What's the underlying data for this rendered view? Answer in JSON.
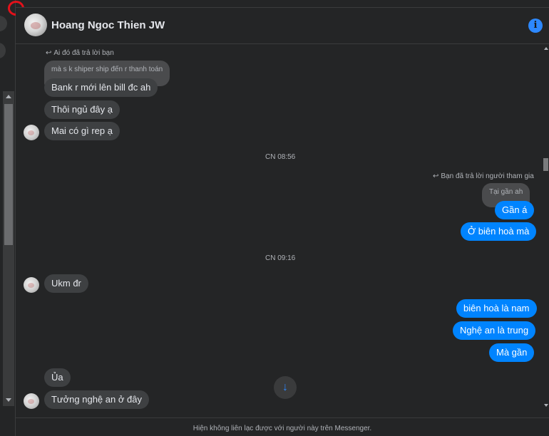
{
  "header": {
    "contact_name": "Hoang Ngoc Thien JW",
    "info_icon": "i"
  },
  "messages": {
    "reply_note_1": "Ai đó đã trả lời bạn",
    "quoted_1": "mà s k shiper ship đến r thanh toán",
    "m1": "Bank r mới lên bill đc ah",
    "m2": "Thôi ngủ đây ạ",
    "m3": "Mai có gì rep ạ",
    "time_1": "CN 08:56",
    "reply_note_2": "Bạn đã trả lời người tham gia",
    "quoted_2": "Tại gần ah",
    "m4": "Gần á",
    "m5": "Ở biên hoà mà",
    "time_2": "CN 09:16",
    "m6": "Ukm đr",
    "m7": "biên hoà là nam",
    "m8": "Nghệ an là trung",
    "m9": "Mà gần",
    "m10": "Ủa",
    "m11": "Tưởng nghệ an ở đây"
  },
  "reply_icon": "↩",
  "scroll_down_icon": "↓",
  "footer": {
    "notice": "Hiện không liên lạc được với người này trên Messenger."
  },
  "colors": {
    "background": "#242526",
    "incoming_bubble": "#3e4042",
    "outgoing_bubble": "#0084ff",
    "accent": "#2d88ff",
    "record_indicator": "#e3111b"
  }
}
